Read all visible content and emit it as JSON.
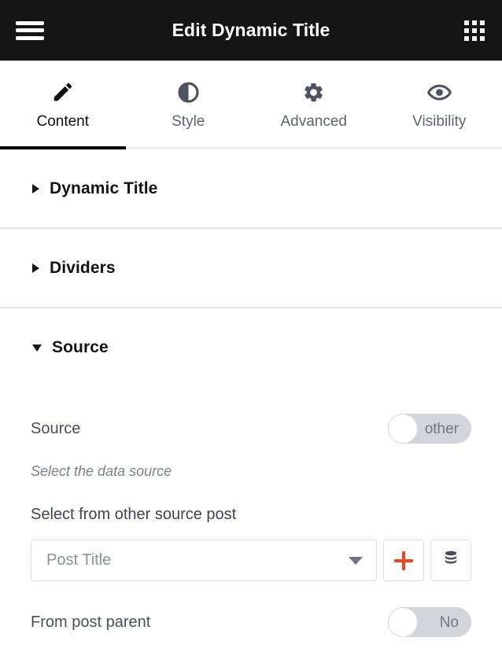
{
  "header": {
    "title": "Edit Dynamic Title",
    "menu_icon": "hamburger-menu-icon",
    "apps_icon": "apps-grid-icon",
    "background_color": "#151515"
  },
  "tabs": [
    {
      "label": "Content",
      "icon": "pencil-icon",
      "active": true
    },
    {
      "label": "Style",
      "icon": "contrast-icon",
      "active": false
    },
    {
      "label": "Advanced",
      "icon": "gear-icon",
      "active": false
    },
    {
      "label": "Visibility",
      "icon": "eye-icon",
      "active": false
    }
  ],
  "sections": [
    {
      "title": "Dynamic Title",
      "expanded": false
    },
    {
      "title": "Dividers",
      "expanded": false
    },
    {
      "title": "Source",
      "expanded": true
    }
  ],
  "source_panel": {
    "source_row": {
      "label": "Source",
      "toggle_value": "other",
      "toggle_on": false
    },
    "helper_text": "Select the data source",
    "select_label": "Select from other source post",
    "select": {
      "value": "Post Title",
      "placeholder": "Post Title",
      "caret_icon": "chevron-down-icon"
    },
    "add_button": {
      "icon": "plus-icon",
      "color": "#ef4523"
    },
    "database_button": {
      "icon": "database-icon",
      "color": "#484d59"
    },
    "from_post_parent": {
      "label": "From post parent",
      "toggle_value": "No",
      "toggle_on": false
    }
  }
}
